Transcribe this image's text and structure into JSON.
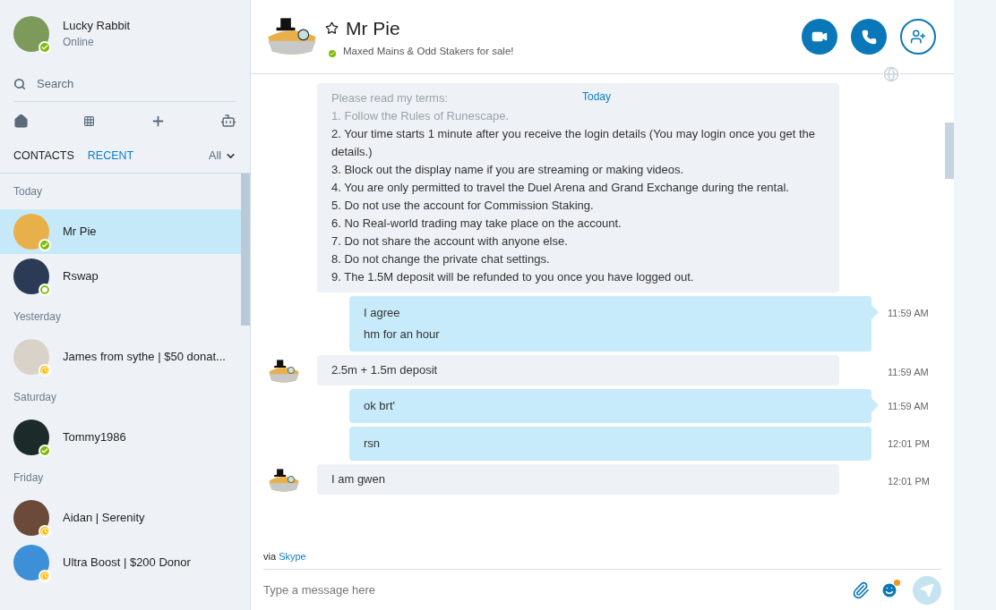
{
  "profile": {
    "name": "Lucky Rabbit",
    "status_text": "Online",
    "kind": "online"
  },
  "search": {
    "placeholder": "Search"
  },
  "tabs": [
    {
      "label": "CONTACTS",
      "selected": false
    },
    {
      "label": "RECENT",
      "selected": true
    }
  ],
  "filter": {
    "label": "All"
  },
  "recent": [
    {
      "heading": "Today",
      "contacts": [
        {
          "name": "Mr Pie",
          "kind": "online",
          "color": "#e8b04a",
          "selected": true
        },
        {
          "name": "Rswap",
          "kind": "offline",
          "color": "#2b3b55",
          "selected": false
        }
      ]
    },
    {
      "heading": "Yesterday",
      "contacts": [
        {
          "name": "James from sythe | $50 donat...",
          "kind": "away",
          "color": "#d9d2c8",
          "selected": false
        }
      ]
    },
    {
      "heading": "Saturday",
      "contacts": [
        {
          "name": "Tommy1986",
          "kind": "online",
          "color": "#1c2a2a",
          "selected": false
        }
      ]
    },
    {
      "heading": "Friday",
      "contacts": [
        {
          "name": "Aidan | Serenity",
          "kind": "away",
          "color": "#6b4a3a",
          "selected": false
        },
        {
          "name": "Ultra Boost | $200 Donor",
          "kind": "away",
          "color": "#3d8fd8",
          "selected": false
        }
      ]
    }
  ],
  "chat": {
    "name": "Mr Pie",
    "favorite": false,
    "kind": "online",
    "mood": "Maxed Mains & Odd Stakers for sale!"
  },
  "day_label": "Today",
  "messages": [
    {
      "kind": "incoming",
      "lines": [
        {
          "text": "Please read my terms:",
          "dimmed": true
        },
        {
          "text": "1. Follow the Rules of Runescape.",
          "dimmed": true
        },
        {
          "text": "2. Your time starts 1 minute after you receive the login details (You may login once you get the details.)",
          "dimmed": false
        },
        {
          "text": "3. Block out the display name if you are streaming or making videos.",
          "dimmed": false
        },
        {
          "text": "4. You are only permitted to travel the Duel Arena and Grand Exchange during the rental.",
          "dimmed": false
        },
        {
          "text": "5. Do not use the account for Commission Staking.",
          "dimmed": false
        },
        {
          "text": "6. No Real-world trading may take place on the account.",
          "dimmed": false
        },
        {
          "text": "7. Do not share the account with anyone else.",
          "dimmed": false
        },
        {
          "text": "8. Do not change the private chat settings.",
          "dimmed": false
        },
        {
          "text": "9. The 1.5M deposit will be refunded to you once you have logged out.",
          "dimmed": false
        }
      ]
    },
    {
      "kind": "outgoing",
      "lines": [
        {
          "text": "I agree",
          "dimmed": false
        },
        {
          "text": "hm for an hour",
          "dimmed": false
        }
      ],
      "time": "11:59 AM",
      "tail": true
    },
    {
      "kind": "incoming",
      "lines": [
        {
          "text": "2.5m + 1.5m deposit",
          "dimmed": false
        }
      ],
      "time": "11:59 AM"
    },
    {
      "kind": "outgoing",
      "lines": [
        {
          "text": "ok brt'",
          "dimmed": false
        }
      ],
      "time": "11:59 AM",
      "tail": true
    },
    {
      "kind": "outgoing",
      "lines": [
        {
          "text": "rsn",
          "dimmed": false
        }
      ],
      "time": "12:01 PM",
      "tail": false
    },
    {
      "kind": "incoming",
      "lines": [
        {
          "text": "I am gwen",
          "dimmed": false
        }
      ],
      "time": "12:01 PM"
    }
  ],
  "via": {
    "prefix": "via",
    "service": "Skype"
  },
  "composer": {
    "placeholder": "Type a message here",
    "emoji_notification": true
  }
}
